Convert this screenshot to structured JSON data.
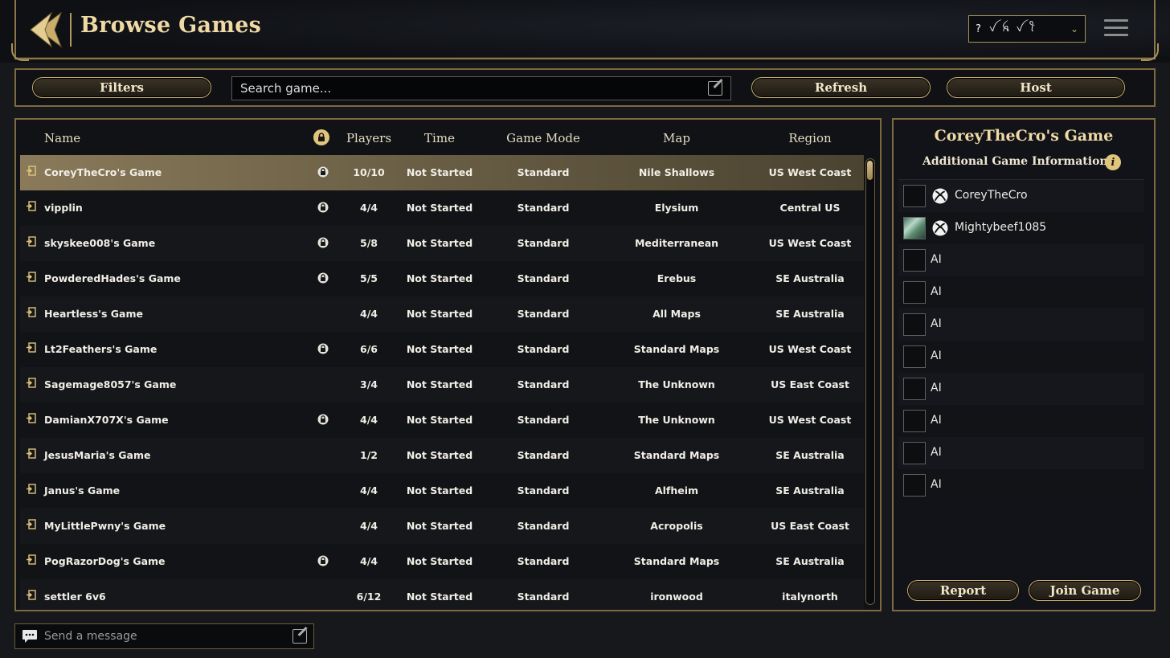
{
  "header": {
    "title": "Browse Games",
    "profile": {
      "prefix": "?",
      "glyphs": "ꪜ ꫝ ꪜ ꪻ",
      "chevron": "⌄"
    }
  },
  "toolbar": {
    "filters_label": "Filters",
    "search_placeholder": "Search game...",
    "refresh_label": "Refresh",
    "host_label": "Host"
  },
  "list": {
    "columns": {
      "name": "Name",
      "players": "Players",
      "time": "Time",
      "mode": "Game Mode",
      "map": "Map",
      "region": "Region"
    },
    "rows": [
      {
        "name": "CoreyTheCro's Game",
        "locked": true,
        "players": "10/10",
        "time": "Not Started",
        "mode": "Standard",
        "map": "Nile Shallows",
        "region": "US West Coast"
      },
      {
        "name": "vipplin",
        "locked": true,
        "players": "4/4",
        "time": "Not Started",
        "mode": "Standard",
        "map": "Elysium",
        "region": "Central US"
      },
      {
        "name": "skyskee008's Game",
        "locked": true,
        "players": "5/8",
        "time": "Not Started",
        "mode": "Standard",
        "map": "Mediterranean",
        "region": "US West Coast"
      },
      {
        "name": "PowderedHades's Game",
        "locked": true,
        "players": "5/5",
        "time": "Not Started",
        "mode": "Standard",
        "map": "Erebus",
        "region": "SE Australia"
      },
      {
        "name": "Heartless's Game",
        "locked": false,
        "players": "4/4",
        "time": "Not Started",
        "mode": "Standard",
        "map": "All Maps",
        "region": "SE Australia"
      },
      {
        "name": "Lt2Feathers's Game",
        "locked": true,
        "players": "6/6",
        "time": "Not Started",
        "mode": "Standard",
        "map": "Standard Maps",
        "region": "US West Coast"
      },
      {
        "name": "Sagemage8057's Game",
        "locked": false,
        "players": "3/4",
        "time": "Not Started",
        "mode": "Standard",
        "map": "The Unknown",
        "region": "US East Coast"
      },
      {
        "name": "DamianX707X's Game",
        "locked": true,
        "players": "4/4",
        "time": "Not Started",
        "mode": "Standard",
        "map": "The Unknown",
        "region": "US West Coast"
      },
      {
        "name": "JesusMaria's Game",
        "locked": false,
        "players": "1/2",
        "time": "Not Started",
        "mode": "Standard",
        "map": "Standard Maps",
        "region": "SE Australia"
      },
      {
        "name": "Janus's Game",
        "locked": false,
        "players": "4/4",
        "time": "Not Started",
        "mode": "Standard",
        "map": "Alfheim",
        "region": "SE Australia"
      },
      {
        "name": "MyLittlePwny's Game",
        "locked": false,
        "players": "4/4",
        "time": "Not Started",
        "mode": "Standard",
        "map": "Acropolis",
        "region": "US East Coast"
      },
      {
        "name": "PogRazorDog's Game",
        "locked": true,
        "players": "4/4",
        "time": "Not Started",
        "mode": "Standard",
        "map": "Standard Maps",
        "region": "SE Australia"
      },
      {
        "name": "settler 6v6",
        "locked": false,
        "players": "6/12",
        "time": "Not Started",
        "mode": "Standard",
        "map": "ironwood",
        "region": "italynorth"
      }
    ]
  },
  "detail": {
    "title": "CoreyTheCro's Game",
    "subtitle": "Additional Game Information:",
    "info_icon": "i",
    "slots": [
      {
        "name": "CoreyTheCro",
        "xbox": true,
        "avatar": false
      },
      {
        "name": "Mightybeef1085",
        "xbox": true,
        "avatar": true
      },
      {
        "name": "AI",
        "xbox": false,
        "avatar": false
      },
      {
        "name": "AI",
        "xbox": false,
        "avatar": false
      },
      {
        "name": "AI",
        "xbox": false,
        "avatar": false
      },
      {
        "name": "AI",
        "xbox": false,
        "avatar": false
      },
      {
        "name": "AI",
        "xbox": false,
        "avatar": false
      },
      {
        "name": "AI",
        "xbox": false,
        "avatar": false
      },
      {
        "name": "AI",
        "xbox": false,
        "avatar": false
      },
      {
        "name": "AI",
        "xbox": false,
        "avatar": false
      }
    ],
    "report_label": "Report",
    "join_label": "Join Game"
  },
  "chat": {
    "placeholder": "Send a message"
  },
  "colors": {
    "gold": "#c9ad6b",
    "title_gold": "#efd9a5",
    "selected_row": "#8a7a5a"
  }
}
